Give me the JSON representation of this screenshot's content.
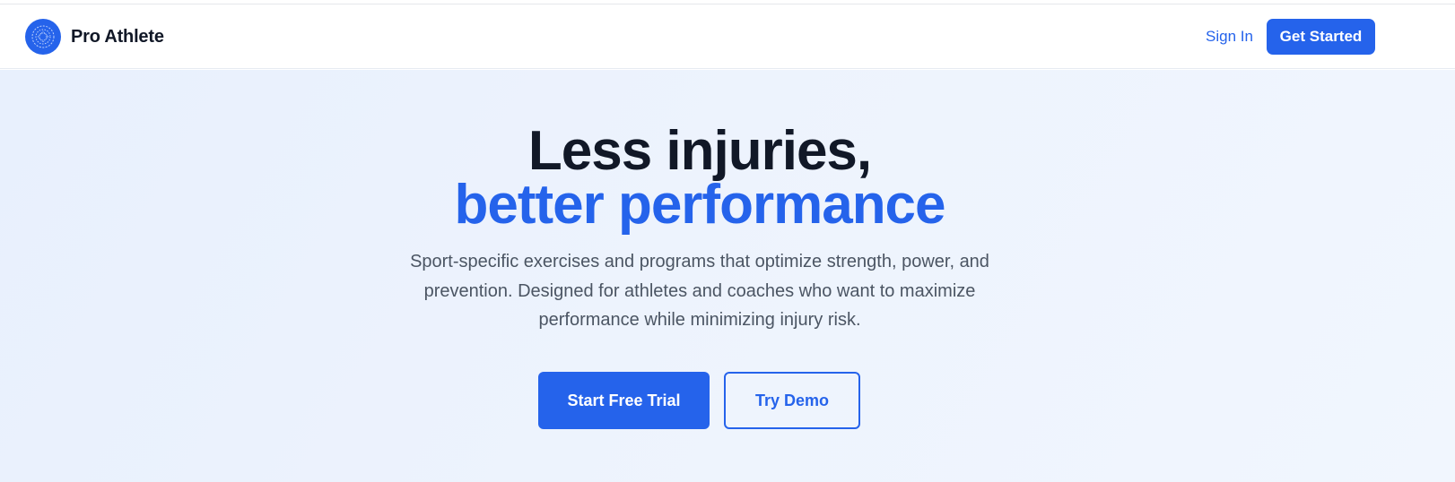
{
  "nav": {
    "brand": "Pro Athlete",
    "logo_icon": "athlete-emblem-icon",
    "sign_in": "Sign In",
    "get_started": "Get Started"
  },
  "hero": {
    "headline_line1": "Less injuries,",
    "headline_line2": "better performance",
    "subtitle": "Sport-specific exercises and programs that optimize strength, power, and prevention. Designed for athletes and coaches who want to maximize performance while minimizing injury risk.",
    "primary_cta": "Start Free Trial",
    "secondary_cta": "Try Demo"
  },
  "colors": {
    "accent": "#2563eb",
    "heading": "#111827",
    "body_text": "#4b5563",
    "hero_background": "#eaf1fd"
  }
}
